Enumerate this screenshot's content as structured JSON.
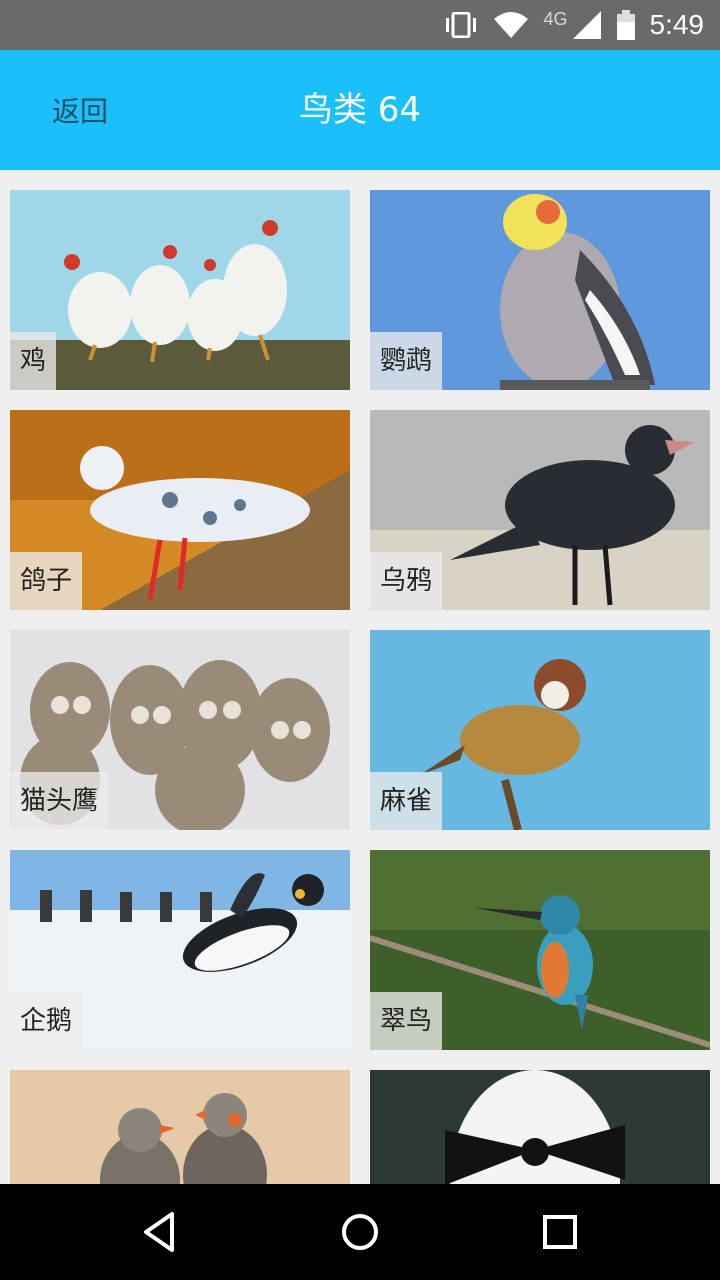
{
  "status_bar": {
    "time": "5:49",
    "network": "4G",
    "icons": [
      "vibrate-icon",
      "wifi-icon",
      "signal-icon",
      "battery-icon"
    ]
  },
  "app_bar": {
    "back_label": "返回",
    "title": "鸟类 64",
    "background": "#1bbffa"
  },
  "birds": [
    {
      "label": "鸡"
    },
    {
      "label": "鹦鹉"
    },
    {
      "label": "鸽子"
    },
    {
      "label": "乌鸦"
    },
    {
      "label": "猫头鹰"
    },
    {
      "label": "麻雀"
    },
    {
      "label": "企鹅"
    },
    {
      "label": "翠鸟"
    },
    {
      "label": ""
    },
    {
      "label": ""
    }
  ],
  "nav_bar": {
    "icons": [
      "back-triangle-icon",
      "home-circle-icon",
      "recents-square-icon"
    ]
  }
}
